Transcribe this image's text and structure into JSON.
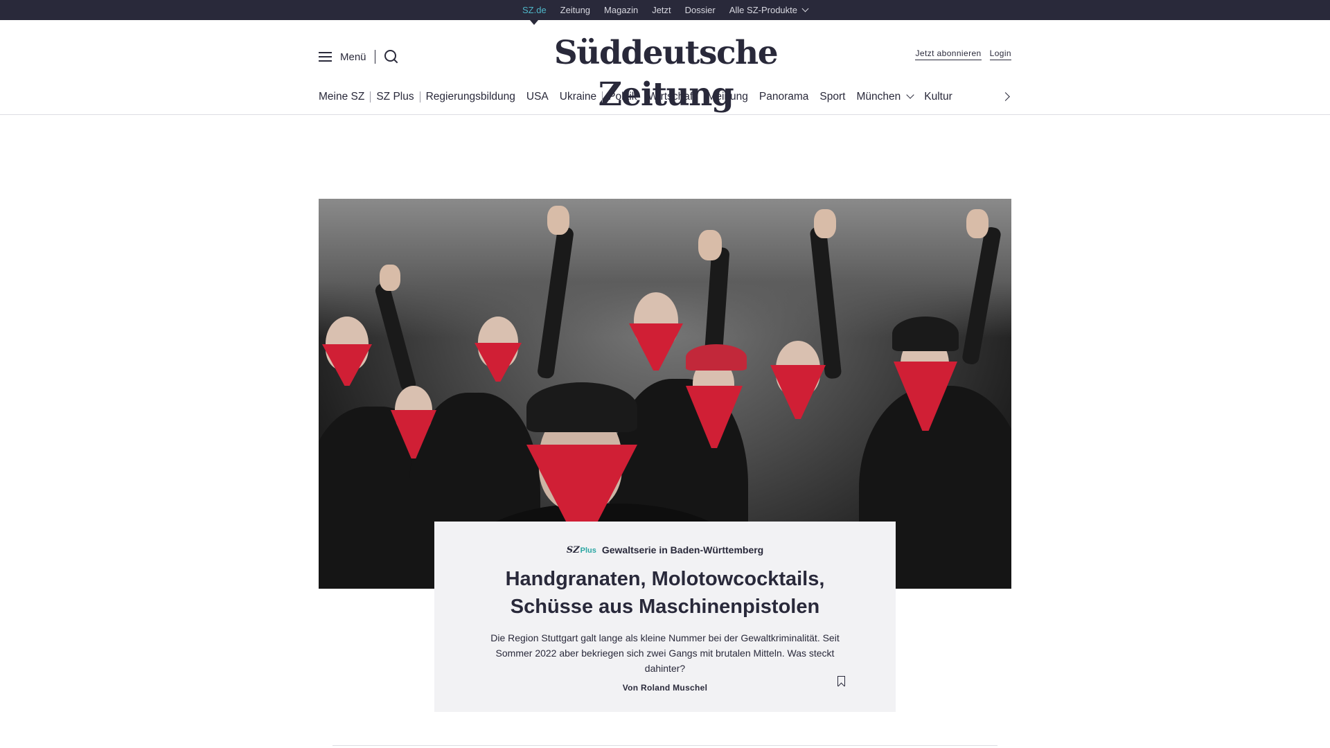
{
  "topbar": {
    "links": [
      "SZ.de",
      "Zeitung",
      "Magazin",
      "Jetzt",
      "Dossier",
      "Alle SZ-Produkte"
    ]
  },
  "masthead": {
    "menu_label": "Menü",
    "logo_text": "Süddeutsche Zeitung",
    "subscribe_label": "Jetzt abonnieren",
    "login_label": "Login"
  },
  "sections": [
    "Meine SZ",
    "SZ Plus",
    "Regierungsbildung",
    "USA",
    "Ukraine",
    "Politik",
    "Wirtschaft",
    "Meinung",
    "Panorama",
    "Sport",
    "München",
    "Kultur"
  ],
  "article": {
    "badge_sz": "SZ",
    "badge_plus": "Plus",
    "kicker": "Gewaltserie in Baden-Württemberg",
    "headline": "Handgranaten, Molotowcocktails, Schüsse aus Maschinenpistolen",
    "teaser": "Die Region Stuttgart galt lange als kleine Nummer bei der Gewaltkriminalität. Seit Sommer 2022 aber bekriegen sich zwei Gangs mit brutalen Mitteln. Was steckt dahinter?",
    "byline": "Von Roland Muschel"
  },
  "colors": {
    "brand_dark": "#29293a",
    "accent_teal": "#2aa6a3",
    "active_link": "#4fb6c8",
    "bandana_red": "#d01f35",
    "card_bg": "#f2f2f4"
  }
}
